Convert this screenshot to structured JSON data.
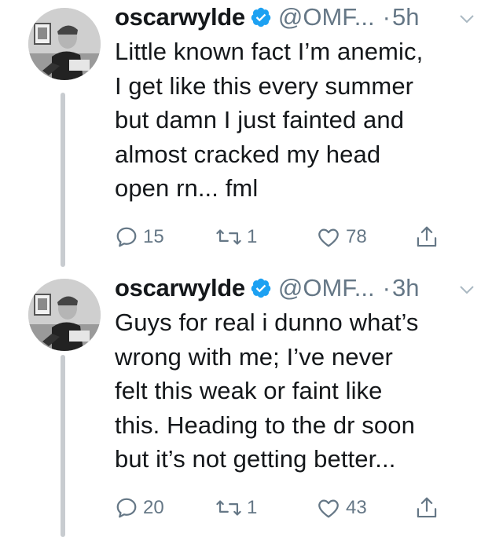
{
  "tweets": [
    {
      "display_name": "oscarwylde",
      "handle": "@OMF...",
      "separator": "·",
      "time": "5h",
      "text": "Little known fact I’m anemic,\nI get like this every summer\nbut damn I just fainted and\nalmost cracked my head\nopen rn... fml",
      "reply_count": "15",
      "retweet_count": "1",
      "like_count": "78"
    },
    {
      "display_name": "oscarwylde",
      "handle": "@OMF...",
      "separator": "·",
      "time": "3h",
      "text": "Guys for real i dunno what’s\nwrong with me; I’ve never\nfelt this weak or faint like\nthis.  Heading to the dr soon\nbut it’s not getting better...",
      "reply_count": "20",
      "retweet_count": "1",
      "like_count": "43"
    }
  ],
  "icons": {
    "verified": "verified-badge-icon",
    "caret": "chevron-down-icon",
    "reply": "reply-icon",
    "retweet": "retweet-icon",
    "like": "heart-icon",
    "share": "share-icon"
  },
  "colors": {
    "verified_blue": "#1da1f2",
    "secondary_text": "#657786",
    "thread_line": "#c8ccd0",
    "primary_text": "#14171a"
  }
}
